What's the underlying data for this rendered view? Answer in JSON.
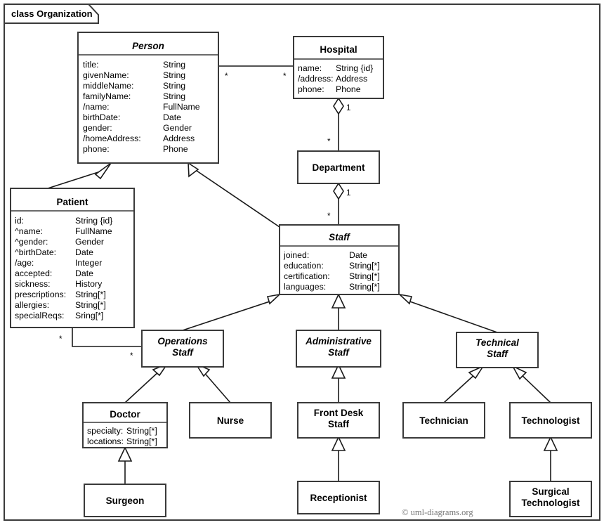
{
  "frame": {
    "title": "class Organization",
    "copyright": "© uml-diagrams.org"
  },
  "classes": {
    "person": {
      "name": "Person",
      "abstract": true,
      "attributes": [
        {
          "name": "title:",
          "type": "String"
        },
        {
          "name": "givenName:",
          "type": "String"
        },
        {
          "name": "middleName:",
          "type": "String"
        },
        {
          "name": "familyName:",
          "type": "String"
        },
        {
          "name": "/name:",
          "type": "FullName"
        },
        {
          "name": "birthDate:",
          "type": "Date"
        },
        {
          "name": "gender:",
          "type": "Gender"
        },
        {
          "name": "/homeAddress:",
          "type": "Address"
        },
        {
          "name": "phone:",
          "type": "Phone"
        }
      ]
    },
    "hospital": {
      "name": "Hospital",
      "abstract": false,
      "attributes": [
        {
          "name": "name:",
          "type": "String {id}"
        },
        {
          "name": "/address:",
          "type": "Address"
        },
        {
          "name": "phone:",
          "type": "Phone"
        }
      ]
    },
    "department": {
      "name": "Department",
      "abstract": false,
      "attributes": []
    },
    "patient": {
      "name": "Patient",
      "abstract": false,
      "attributes": [
        {
          "name": "id:",
          "type": "String {id}"
        },
        {
          "name": "^name:",
          "type": "FullName"
        },
        {
          "name": "^gender:",
          "type": "Gender"
        },
        {
          "name": "^birthDate:",
          "type": "Date"
        },
        {
          "name": "/age:",
          "type": "Integer"
        },
        {
          "name": "accepted:",
          "type": "Date"
        },
        {
          "name": "sickness:",
          "type": "History"
        },
        {
          "name": "prescriptions:",
          "type": "String[*]"
        },
        {
          "name": "allergies:",
          "type": "String[*]"
        },
        {
          "name": "specialReqs:",
          "type": "Sring[*]"
        }
      ]
    },
    "staff": {
      "name": "Staff",
      "abstract": true,
      "attributes": [
        {
          "name": "joined:",
          "type": "Date"
        },
        {
          "name": "education:",
          "type": "String[*]"
        },
        {
          "name": "certification:",
          "type": "String[*]"
        },
        {
          "name": "languages:",
          "type": "String[*]"
        }
      ]
    },
    "operations_staff": {
      "name": "Operations Staff",
      "line1": "Operations",
      "line2": "Staff",
      "abstract": true,
      "attributes": []
    },
    "administrative_staff": {
      "name": "Administrative Staff",
      "line1": "Administrative",
      "line2": "Staff",
      "abstract": true,
      "attributes": []
    },
    "technical_staff": {
      "name": "Technical Staff",
      "line1": "Technical",
      "line2": "Staff",
      "abstract": true,
      "attributes": []
    },
    "doctor": {
      "name": "Doctor",
      "abstract": false,
      "attributes": [
        {
          "name": "specialty:",
          "type": "String[*]"
        },
        {
          "name": "locations:",
          "type": "String[*]"
        }
      ]
    },
    "nurse": {
      "name": "Nurse",
      "abstract": false,
      "attributes": []
    },
    "front_desk_staff": {
      "name": "Front Desk Staff",
      "line1": "Front Desk",
      "line2": "Staff",
      "abstract": false,
      "attributes": []
    },
    "technician": {
      "name": "Technician",
      "abstract": false,
      "attributes": []
    },
    "technologist": {
      "name": "Technologist",
      "abstract": false,
      "attributes": []
    },
    "surgeon": {
      "name": "Surgeon",
      "abstract": false,
      "attributes": []
    },
    "receptionist": {
      "name": "Receptionist",
      "abstract": false,
      "attributes": []
    },
    "surgical_technologist": {
      "name": "Surgical Technologist",
      "line1": "Surgical",
      "line2": "Technologist",
      "abstract": false,
      "attributes": []
    }
  },
  "multiplicities": {
    "person_hospital_source": "*",
    "person_hospital_target": "*",
    "hospital_department_whole": "1",
    "hospital_department_part": "*",
    "department_staff_whole": "1",
    "department_staff_part": "*",
    "patient_doctor_source": "*",
    "patient_doctor_target": "*"
  },
  "relationships": [
    {
      "kind": "association",
      "from": "Person",
      "to": "Hospital"
    },
    {
      "kind": "aggregation",
      "from": "Hospital",
      "to": "Department"
    },
    {
      "kind": "aggregation",
      "from": "Department",
      "to": "Staff"
    },
    {
      "kind": "association",
      "from": "Patient",
      "to": "Operations Staff"
    },
    {
      "kind": "generalization",
      "from": "Patient",
      "to": "Person"
    },
    {
      "kind": "generalization",
      "from": "Staff",
      "to": "Person"
    },
    {
      "kind": "generalization",
      "from": "Operations Staff",
      "to": "Staff"
    },
    {
      "kind": "generalization",
      "from": "Administrative Staff",
      "to": "Staff"
    },
    {
      "kind": "generalization",
      "from": "Technical Staff",
      "to": "Staff"
    },
    {
      "kind": "generalization",
      "from": "Doctor",
      "to": "Operations Staff"
    },
    {
      "kind": "generalization",
      "from": "Nurse",
      "to": "Operations Staff"
    },
    {
      "kind": "generalization",
      "from": "Front Desk Staff",
      "to": "Administrative Staff"
    },
    {
      "kind": "generalization",
      "from": "Technician",
      "to": "Technical Staff"
    },
    {
      "kind": "generalization",
      "from": "Technologist",
      "to": "Technical Staff"
    },
    {
      "kind": "generalization",
      "from": "Surgeon",
      "to": "Doctor"
    },
    {
      "kind": "generalization",
      "from": "Receptionist",
      "to": "Front Desk Staff"
    },
    {
      "kind": "generalization",
      "from": "Surgical Technologist",
      "to": "Technologist"
    }
  ]
}
